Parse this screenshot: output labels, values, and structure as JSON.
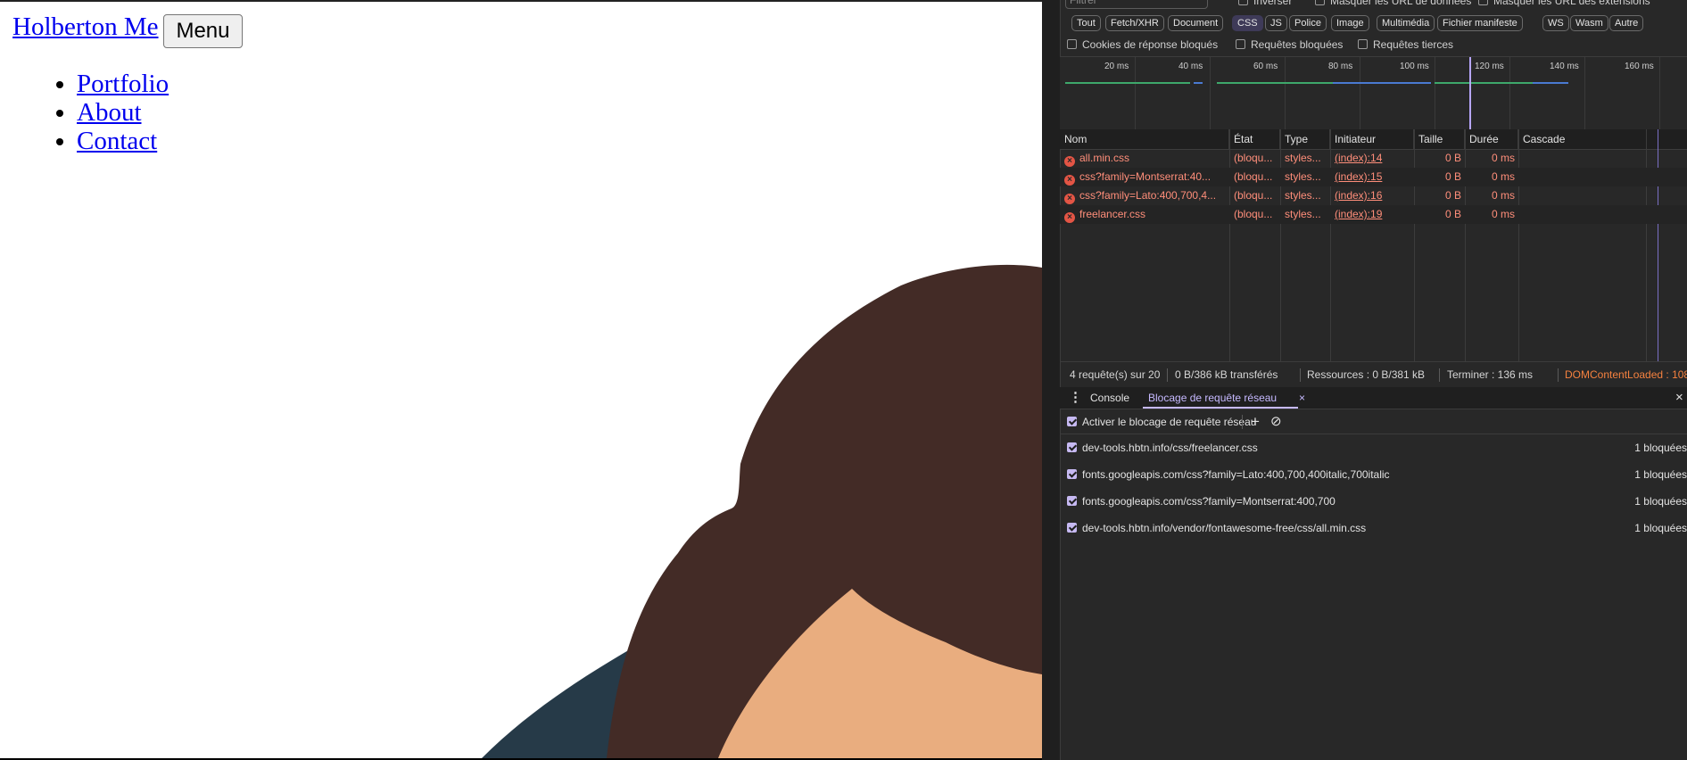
{
  "page": {
    "brand": "Holberton Me",
    "menu_button": "Menu",
    "nav": [
      "Portfolio",
      "About",
      "Contact"
    ]
  },
  "colors": {
    "link": "#0000ee",
    "hair": "#432b26",
    "skin": "#e9ad7f",
    "shirt": "#263a48",
    "devtools_bg": "#282828",
    "accent": "#c6b9ff",
    "error": "#ff8e7a"
  },
  "devtools": {
    "filter_placeholder": "Filtrer",
    "top_options": [
      "Inverser",
      "Masquer les URL de données",
      "Masquer les URL des extensions"
    ],
    "chips": [
      "Tout",
      "Fetch/XHR",
      "Document",
      "CSS",
      "JS",
      "Police",
      "Image",
      "Multimédia",
      "Fichier manifeste",
      "WS",
      "Wasm",
      "Autre"
    ],
    "active_chip": "CSS",
    "options2": [
      "Cookies de réponse bloqués",
      "Requêtes bloquées",
      "Requêtes tierces"
    ],
    "timeline_ticks": [
      "20 ms",
      "40 ms",
      "60 ms",
      "80 ms",
      "100 ms",
      "120 ms",
      "140 ms",
      "160 ms"
    ],
    "columns": [
      "Nom",
      "État",
      "Type",
      "Initiateur",
      "Taille",
      "Durée",
      "Cascade"
    ],
    "rows": [
      {
        "name": "all.min.css",
        "status": "(bloqu...",
        "type": "styles...",
        "initiator": "(index):14",
        "size": "0 B",
        "time": "0 ms"
      },
      {
        "name": "css?family=Montserrat:40...",
        "status": "(bloqu...",
        "type": "styles...",
        "initiator": "(index):15",
        "size": "0 B",
        "time": "0 ms"
      },
      {
        "name": "css?family=Lato:400,700,4...",
        "status": "(bloqu...",
        "type": "styles...",
        "initiator": "(index):16",
        "size": "0 B",
        "time": "0 ms"
      },
      {
        "name": "freelancer.css",
        "status": "(bloqu...",
        "type": "styles...",
        "initiator": "(index):19",
        "size": "0 B",
        "time": "0 ms"
      }
    ],
    "status_bar": {
      "requests": "4 requête(s) sur 20",
      "transferred": "0 B/386 kB transférés",
      "resources": "Ressources : 0 B/381 kB",
      "finish": "Terminer : 136 ms",
      "dcl": "DOMContentLoaded : 108"
    },
    "drawer_tabs": [
      "Console",
      "Blocage de requête réseau"
    ],
    "enable_blocking_label": "Activer le blocage de requête réseau",
    "blocked_patterns": [
      {
        "pattern": "dev-tools.hbtn.info/css/freelancer.css",
        "count": "1 bloquées"
      },
      {
        "pattern": "fonts.googleapis.com/css?family=Lato:400,700,400italic,700italic",
        "count": "1 bloquées"
      },
      {
        "pattern": "fonts.googleapis.com/css?family=Montserrat:400,700",
        "count": "1 bloquées"
      },
      {
        "pattern": "dev-tools.hbtn.info/vendor/fontawesome-free/css/all.min.css",
        "count": "1 bloquées"
      }
    ]
  }
}
